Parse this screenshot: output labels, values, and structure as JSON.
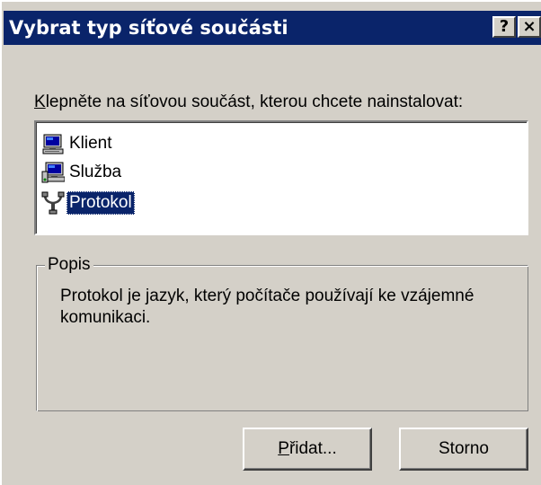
{
  "window": {
    "title": "Vybrat typ síťové součásti",
    "help_button": "?",
    "close_button": "×"
  },
  "prompt": {
    "accel_char": "K",
    "rest": "lepněte na síťovou součást, kterou chcete nainstalovat:"
  },
  "list": {
    "items": [
      {
        "label": "Klient",
        "icon": "client-computer-icon",
        "selected": false
      },
      {
        "label": "Služba",
        "icon": "service-computer-icon",
        "selected": false
      },
      {
        "label": "Protokol",
        "icon": "protocol-cable-icon",
        "selected": true
      }
    ]
  },
  "description": {
    "legend": "Popis",
    "text": "Protokol je jazyk, který počítače používají ke vzájemné komunikaci."
  },
  "buttons": {
    "add_accel": "P",
    "add_rest": "řidat...",
    "cancel": "Storno"
  },
  "colors": {
    "title_bar": "#0a246a",
    "face": "#d4d0c8",
    "selection": "#0a246a"
  }
}
